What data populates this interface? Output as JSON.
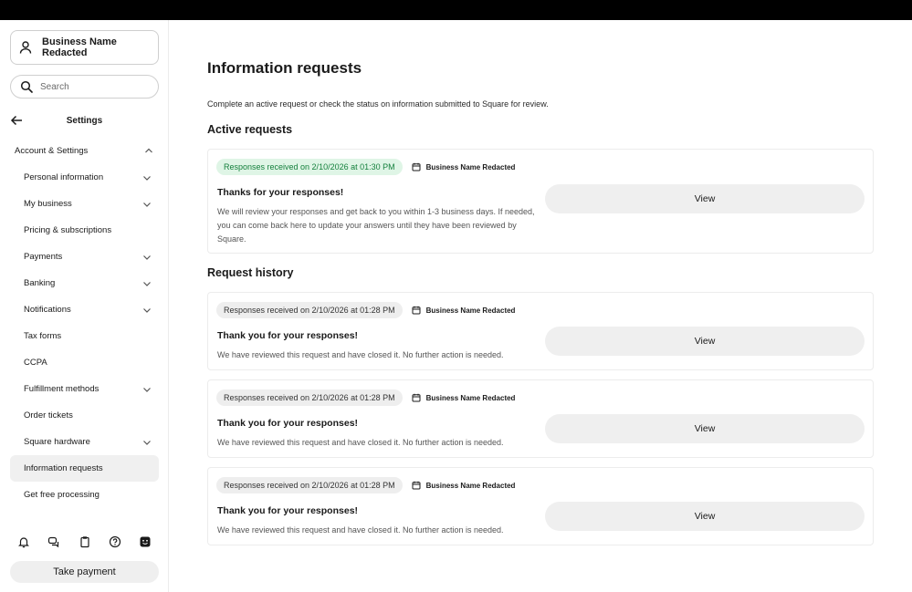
{
  "sidebar": {
    "business_name": "Business Name Redacted",
    "search_placeholder": "Search",
    "settings_title": "Settings",
    "section_label": "Account & Settings",
    "items": [
      {
        "label": "Personal information",
        "chevron": true
      },
      {
        "label": "My business",
        "chevron": true
      },
      {
        "label": "Pricing & subscriptions",
        "chevron": false
      },
      {
        "label": "Payments",
        "chevron": true
      },
      {
        "label": "Banking",
        "chevron": true
      },
      {
        "label": "Notifications",
        "chevron": true
      },
      {
        "label": "Tax forms",
        "chevron": false
      },
      {
        "label": "CCPA",
        "chevron": false
      },
      {
        "label": "Fulfillment methods",
        "chevron": true
      },
      {
        "label": "Order tickets",
        "chevron": false
      },
      {
        "label": "Square hardware",
        "chevron": true
      },
      {
        "label": "Information requests",
        "chevron": false,
        "active": true
      },
      {
        "label": "Get free processing",
        "chevron": false
      }
    ],
    "bottom_icons": [
      "bell-icon",
      "chat-icon",
      "clipboard-icon",
      "help-icon",
      "smiley-icon"
    ],
    "take_payment_label": "Take payment"
  },
  "main": {
    "title": "Information requests",
    "description": "Complete an active request or check the status on information submitted to Square for review.",
    "active_title": "Active requests",
    "history_title": "Request history",
    "active": {
      "status": "Responses received on 2/10/2026 at 01:30 PM",
      "status_color": "#15803d",
      "owner": "Business Name Redacted",
      "heading": "Thanks for your responses!",
      "body_lines": [
        "We will review your responses and get back to you within 1-3 business days. If needed,",
        "you can come back here to update your answers until they have been reviewed by",
        "Square."
      ],
      "button": "View"
    },
    "history": [
      {
        "status": "Responses received on 2/10/2026 at 01:28 PM",
        "owner": "Business Name Redacted",
        "heading": "Thank you for your responses!",
        "body": "We have reviewed this request and have closed it. No further action is needed.",
        "button": "View"
      },
      {
        "status": "Responses received on 2/10/2026 at 01:28 PM",
        "owner": "Business Name Redacted",
        "heading": "Thank you for your responses!",
        "body": "We have reviewed this request and have closed it. No further action is needed.",
        "button": "View"
      },
      {
        "status": "Responses received on 2/10/2026 at 01:28 PM",
        "owner": "Business Name Redacted",
        "heading": "Thank you for your responses!",
        "body": "We have reviewed this request and have closed it. No further action is needed.",
        "button": "View"
      }
    ]
  }
}
